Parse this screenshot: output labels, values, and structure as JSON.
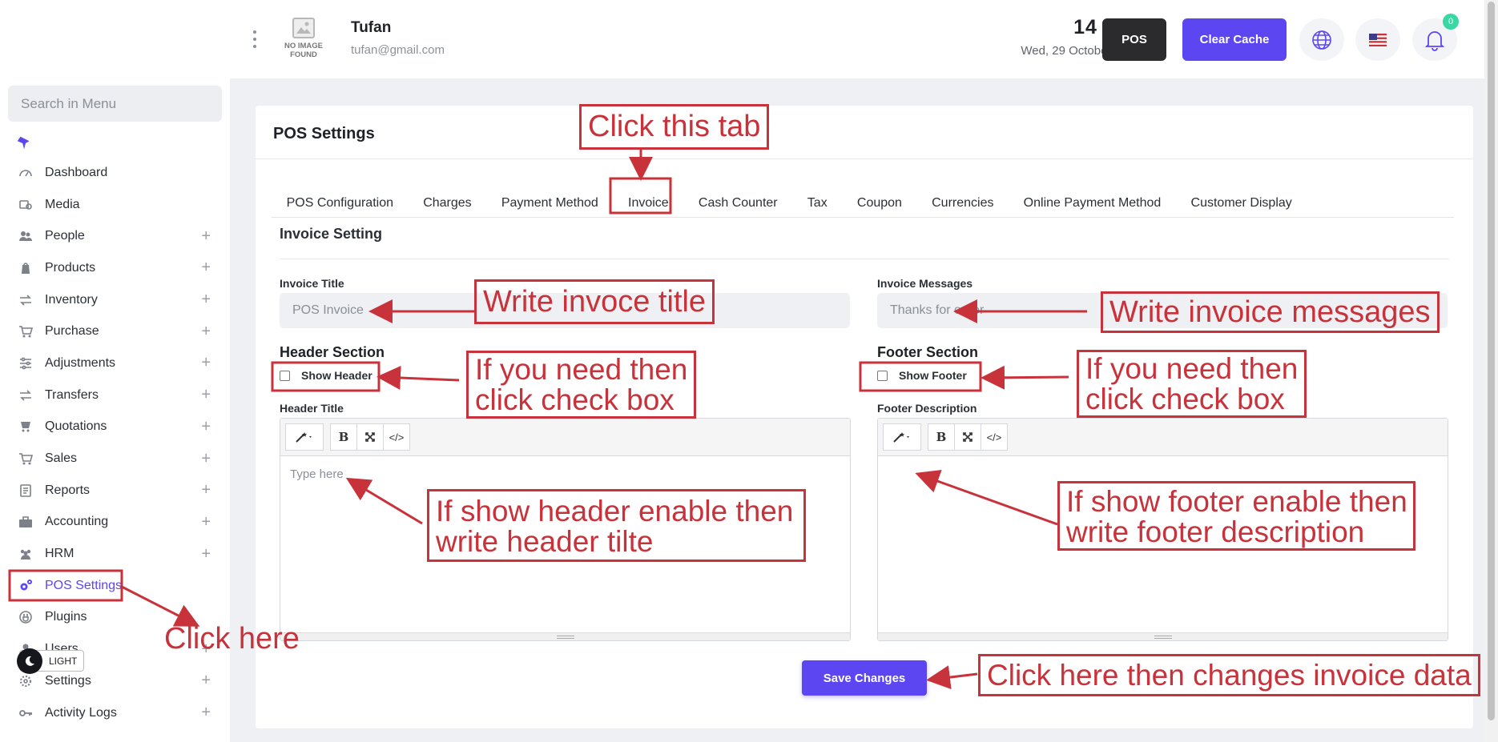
{
  "sidebar": {
    "search_placeholder": "Search in Menu",
    "items": [
      {
        "label": "Dashboard",
        "icon": "gauge-icon",
        "expandable": false
      },
      {
        "label": "Media",
        "icon": "media-icon",
        "expandable": false
      },
      {
        "label": "People",
        "icon": "people-icon",
        "expandable": true
      },
      {
        "label": "Products",
        "icon": "products-icon",
        "expandable": true
      },
      {
        "label": "Inventory",
        "icon": "inventory-icon",
        "expandable": true
      },
      {
        "label": "Purchase",
        "icon": "cart-icon",
        "expandable": true
      },
      {
        "label": "Adjustments",
        "icon": "sliders-icon",
        "expandable": true
      },
      {
        "label": "Transfers",
        "icon": "transfer-icon",
        "expandable": true
      },
      {
        "label": "Quotations",
        "icon": "quote-icon",
        "expandable": true
      },
      {
        "label": "Sales",
        "icon": "cart-icon",
        "expandable": true
      },
      {
        "label": "Reports",
        "icon": "report-icon",
        "expandable": true
      },
      {
        "label": "Accounting",
        "icon": "briefcase-icon",
        "expandable": true
      },
      {
        "label": "HRM",
        "icon": "team-icon",
        "expandable": true
      },
      {
        "label": "POS Settings",
        "icon": "gears-icon",
        "expandable": false,
        "active": true
      },
      {
        "label": "Plugins",
        "icon": "plug-icon",
        "expandable": false
      },
      {
        "label": "Users",
        "icon": "user-icon",
        "expandable": true
      },
      {
        "label": "Settings",
        "icon": "gear-icon",
        "expandable": true
      },
      {
        "label": "Activity Logs",
        "icon": "key-icon",
        "expandable": true
      }
    ],
    "theme_label": "LIGHT"
  },
  "header": {
    "user_name": "Tufan",
    "user_email": "tufan@gmail.com",
    "avatar_text_1": "NO IMAGE",
    "avatar_text_2": "FOUND",
    "time": "14 : 45",
    "date": "Wed, 29 October 2025",
    "pos_label": "POS",
    "clear_cache_label": "Clear Cache",
    "notification_count": "0"
  },
  "page": {
    "title": "POS Settings",
    "tabs": [
      "POS Configuration",
      "Charges",
      "Payment Method",
      "Invoice",
      "Cash Counter",
      "Tax",
      "Coupon",
      "Currencies",
      "Online Payment Method",
      "Customer Display"
    ],
    "active_tab": "Invoice",
    "section_title": "Invoice Setting",
    "invoice_title_label": "Invoice Title",
    "invoice_title_value": "POS Invoice",
    "invoice_messages_label": "Invoice Messages",
    "invoice_messages_value": "Thanks for order",
    "header_section_title": "Header Section",
    "show_header_label": "Show Header",
    "header_title_label": "Header Title",
    "header_placeholder": "Type here",
    "footer_section_title": "Footer Section",
    "show_footer_label": "Show Footer",
    "footer_description_label": "Footer Description",
    "save_label": "Save Changes"
  },
  "annotations": {
    "click_tab": "Click this tab",
    "write_title": "Write invoce title",
    "write_messages": "Write invoice messages",
    "check_header_1": "If you need then",
    "check_header_2": "click check box",
    "check_footer_1": "If you need then",
    "check_footer_2": "click check box",
    "header_help_1": "If show header enable then",
    "header_help_2": "write header tilte",
    "footer_help_1": "If show footer enable then",
    "footer_help_2": "write footer description",
    "click_here": "Click here",
    "save_help": "Click here then changes invoice data"
  },
  "colors": {
    "accent": "#5b46f2",
    "annotation": "#c8323a",
    "dark_button": "#2b2b2d"
  }
}
